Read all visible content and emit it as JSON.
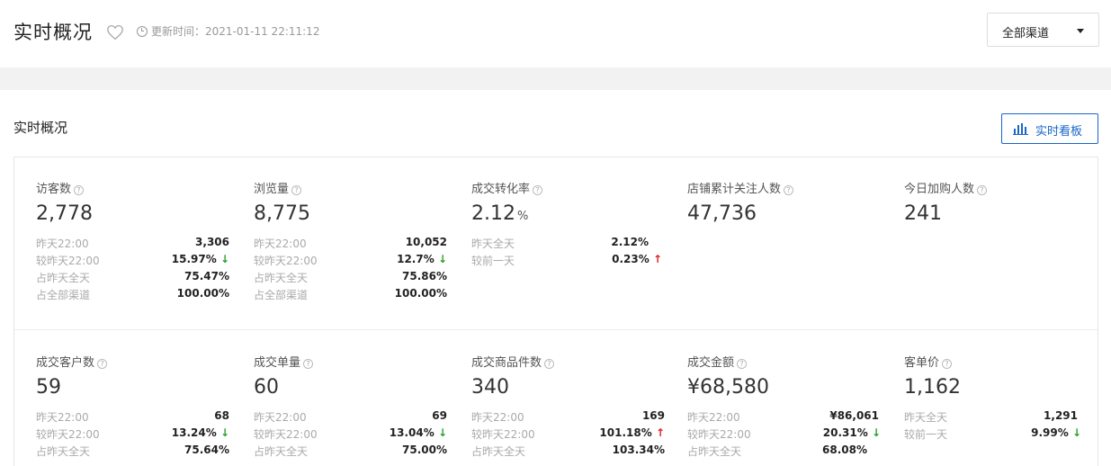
{
  "header": {
    "title": "实时概况",
    "update_text": "更新时间：2021-01-11 22:11:12",
    "channel_select": "全部渠道"
  },
  "section": {
    "title": "实时概况",
    "board_button": "实时看板"
  },
  "row1": [
    {
      "label": "访客数",
      "value": "2,778",
      "unit": "",
      "stats": [
        {
          "k": "昨天22:00",
          "v": "3,306",
          "arrow": ""
        },
        {
          "k": "较昨天22:00",
          "v": "15.97%",
          "arrow": "down"
        },
        {
          "k": "占昨天全天",
          "v": "75.47%",
          "arrow": ""
        },
        {
          "k": "占全部渠道",
          "v": "100.00%",
          "arrow": ""
        }
      ]
    },
    {
      "label": "浏览量",
      "value": "8,775",
      "unit": "",
      "stats": [
        {
          "k": "昨天22:00",
          "v": "10,052",
          "arrow": ""
        },
        {
          "k": "较昨天22:00",
          "v": "12.7%",
          "arrow": "down"
        },
        {
          "k": "占昨天全天",
          "v": "75.86%",
          "arrow": ""
        },
        {
          "k": "占全部渠道",
          "v": "100.00%",
          "arrow": ""
        }
      ]
    },
    {
      "label": "成交转化率",
      "value": "2.12",
      "unit": "%",
      "stats": [
        {
          "k": "昨天全天",
          "v": "2.12%",
          "arrow": ""
        },
        {
          "k": "较前一天",
          "v": "0.23%",
          "arrow": "up"
        }
      ]
    },
    {
      "label": "店铺累计关注人数",
      "value": "47,736",
      "unit": "",
      "stats": []
    },
    {
      "label": "今日加购人数",
      "value": "241",
      "unit": "",
      "stats": []
    }
  ],
  "row2": [
    {
      "label": "成交客户数",
      "value": "59",
      "unit": "",
      "stats": [
        {
          "k": "昨天22:00",
          "v": "68",
          "arrow": ""
        },
        {
          "k": "较昨天22:00",
          "v": "13.24%",
          "arrow": "down"
        },
        {
          "k": "占昨天全天",
          "v": "75.64%",
          "arrow": ""
        }
      ]
    },
    {
      "label": "成交单量",
      "value": "60",
      "unit": "",
      "stats": [
        {
          "k": "昨天22:00",
          "v": "69",
          "arrow": ""
        },
        {
          "k": "较昨天22:00",
          "v": "13.04%",
          "arrow": "down"
        },
        {
          "k": "占昨天全天",
          "v": "75.00%",
          "arrow": ""
        }
      ]
    },
    {
      "label": "成交商品件数",
      "value": "340",
      "unit": "",
      "stats": [
        {
          "k": "昨天22:00",
          "v": "169",
          "arrow": ""
        },
        {
          "k": "较昨天22:00",
          "v": "101.18%",
          "arrow": "up"
        },
        {
          "k": "占昨天全天",
          "v": "103.34%",
          "arrow": ""
        }
      ]
    },
    {
      "label": "成交金额",
      "value": "¥68,580",
      "unit": "",
      "stats": [
        {
          "k": "昨天22:00",
          "v": "¥86,061",
          "arrow": ""
        },
        {
          "k": "较昨天22:00",
          "v": "20.31%",
          "arrow": "down"
        },
        {
          "k": "占昨天全天",
          "v": "68.08%",
          "arrow": ""
        }
      ]
    },
    {
      "label": "客单价",
      "value": "1,162",
      "unit": "",
      "stats": [
        {
          "k": "昨天全天",
          "v": "1,291",
          "arrow": ""
        },
        {
          "k": "较前一天",
          "v": "9.99%",
          "arrow": "down"
        }
      ]
    }
  ],
  "colors": {
    "accent": "#1a66c8",
    "up": "#e02020",
    "down": "#2aa02a"
  },
  "icons": {
    "favorite": "heart-outline-icon",
    "time": "clock-icon",
    "board": "bar-chart-icon",
    "help": "question-circle-icon"
  }
}
